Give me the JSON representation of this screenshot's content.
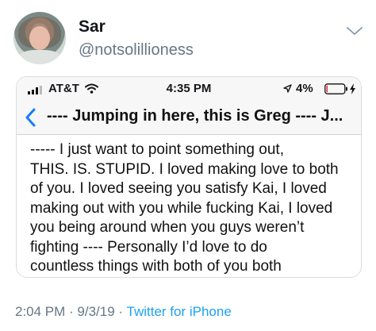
{
  "user": {
    "name": "Sar",
    "handle": "@notsolillioness"
  },
  "screenshot": {
    "status": {
      "carrier": "AT&T",
      "time": "4:35 PM",
      "battery": "4%",
      "battery_level": 0.04
    },
    "nav_title": "---- Jumping in here, this is Greg ---- J...",
    "message_lines": [
      "----- I just want to point something out,",
      "THIS. IS. STUPID. I loved making love to both",
      "of you. I loved seeing you satisfy Kai, I loved",
      "making out with you while fucking Kai, I loved",
      "you being around when you guys weren’t",
      "fighting ---- Personally I’d love to do",
      "countless things with both of you both"
    ]
  },
  "footer": {
    "time": "2:04 PM",
    "sep1": " · ",
    "date": "9/3/19",
    "sep2": " · ",
    "source": "Twitter for iPhone"
  },
  "colors": {
    "ios_blue": "#147efb",
    "twitter_blue": "#1da1f2",
    "muted": "#657786"
  },
  "icons": {
    "menu": "chevron-down-icon",
    "back": "back-chevron-icon",
    "signal": "cellular-signal-icon",
    "wifi": "wifi-icon",
    "location": "location-arrow-icon",
    "battery": "battery-icon",
    "charging": "charging-bolt-icon"
  }
}
